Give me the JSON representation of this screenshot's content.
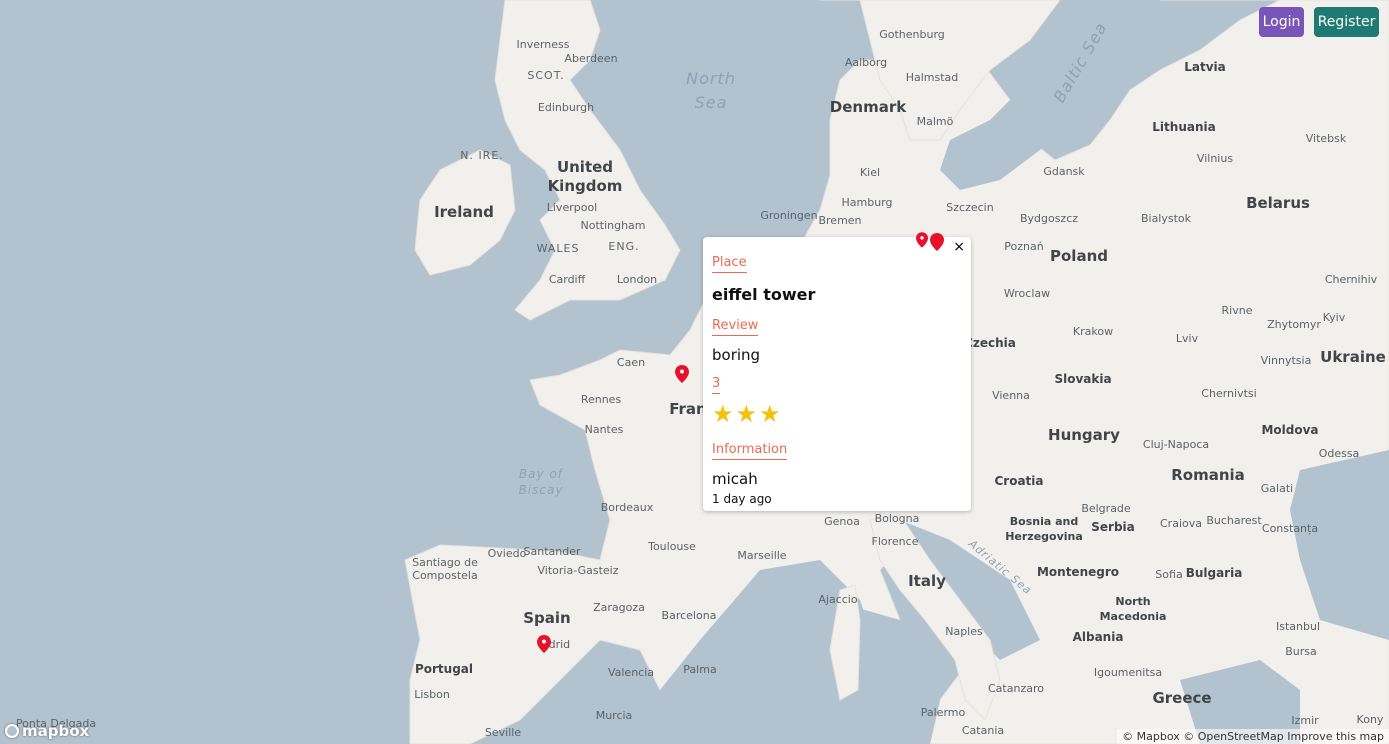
{
  "header": {
    "login_label": "Login",
    "register_label": "Register"
  },
  "popup": {
    "place_label": "Place",
    "place_value": "eiffel tower",
    "review_label": "Review",
    "review_value": "boring",
    "rating_label": "3",
    "rating": 3,
    "info_label": "Information",
    "user": "micah",
    "time_ago": "1 day ago",
    "close_glyph": "×"
  },
  "map": {
    "attribution": "© Mapbox © OpenStreetMap Improve this map",
    "logo_text": "mapbox",
    "marker_color": "#e8102a",
    "seas": [
      "North Sea",
      "Baltic Sea",
      "Bay of Biscay",
      "Adriatic Sea"
    ],
    "countries": [
      "Ireland",
      "United Kingdom",
      "Denmark",
      "Latvia",
      "Lithuania",
      "Belarus",
      "Poland",
      "Ukraine",
      "Czechia",
      "Slovakia",
      "Hungary",
      "Romania",
      "Moldova",
      "Croatia",
      "Bosnia and Herzegovina",
      "Serbia",
      "Bulgaria",
      "Montenegro",
      "North Macedonia",
      "Albania",
      "Greece",
      "Italy",
      "Spain",
      "Portugal",
      "Fran"
    ],
    "cities": [
      "Inverness",
      "Aberdeen",
      "SCOT.",
      "Edinburgh",
      "N. IRE.",
      "Liverpool",
      "Nottingham",
      "WALES",
      "ENG.",
      "Cardiff",
      "London",
      "Gothenburg",
      "Aalborg",
      "Halmstad",
      "Malmö",
      "Kiel",
      "Hamburg",
      "Groningen",
      "Bremen",
      "Szczecin",
      "Gdansk",
      "Vilnius",
      "Vitebsk",
      "Bydgoszcz",
      "Bialystok",
      "Poznań",
      "Wroclaw",
      "Krakow",
      "Rivne",
      "Zhytomyr",
      "Kyiv",
      "Chernihiv",
      "Lviv",
      "Vinnytsia",
      "Chernivtsi",
      "Vienna",
      "Cluj-Napoca",
      "Odessa",
      "Galati",
      "Belgrade",
      "Craiova",
      "Bucharest",
      "Constanța",
      "Sofia",
      "Istanbul",
      "Bursa",
      "Caen",
      "Rennes",
      "Nantes",
      "Bordeaux",
      "Toulouse",
      "Marseille",
      "Genoa",
      "Bologna",
      "Florence",
      "Ajaccio",
      "Naples",
      "Palermo",
      "Catania",
      "Catanzaro",
      "Igoumenitsa",
      "Izmir",
      "Oviedo",
      "Santander",
      "Santiago de Compostela",
      "Vitoria-Gasteiz",
      "Zaragoza",
      "Barcelona",
      "adrid",
      "Valencia",
      "Palma",
      "Lisbon",
      "Murcia",
      "Seville",
      "Ponta Delgada",
      "Kony"
    ]
  }
}
